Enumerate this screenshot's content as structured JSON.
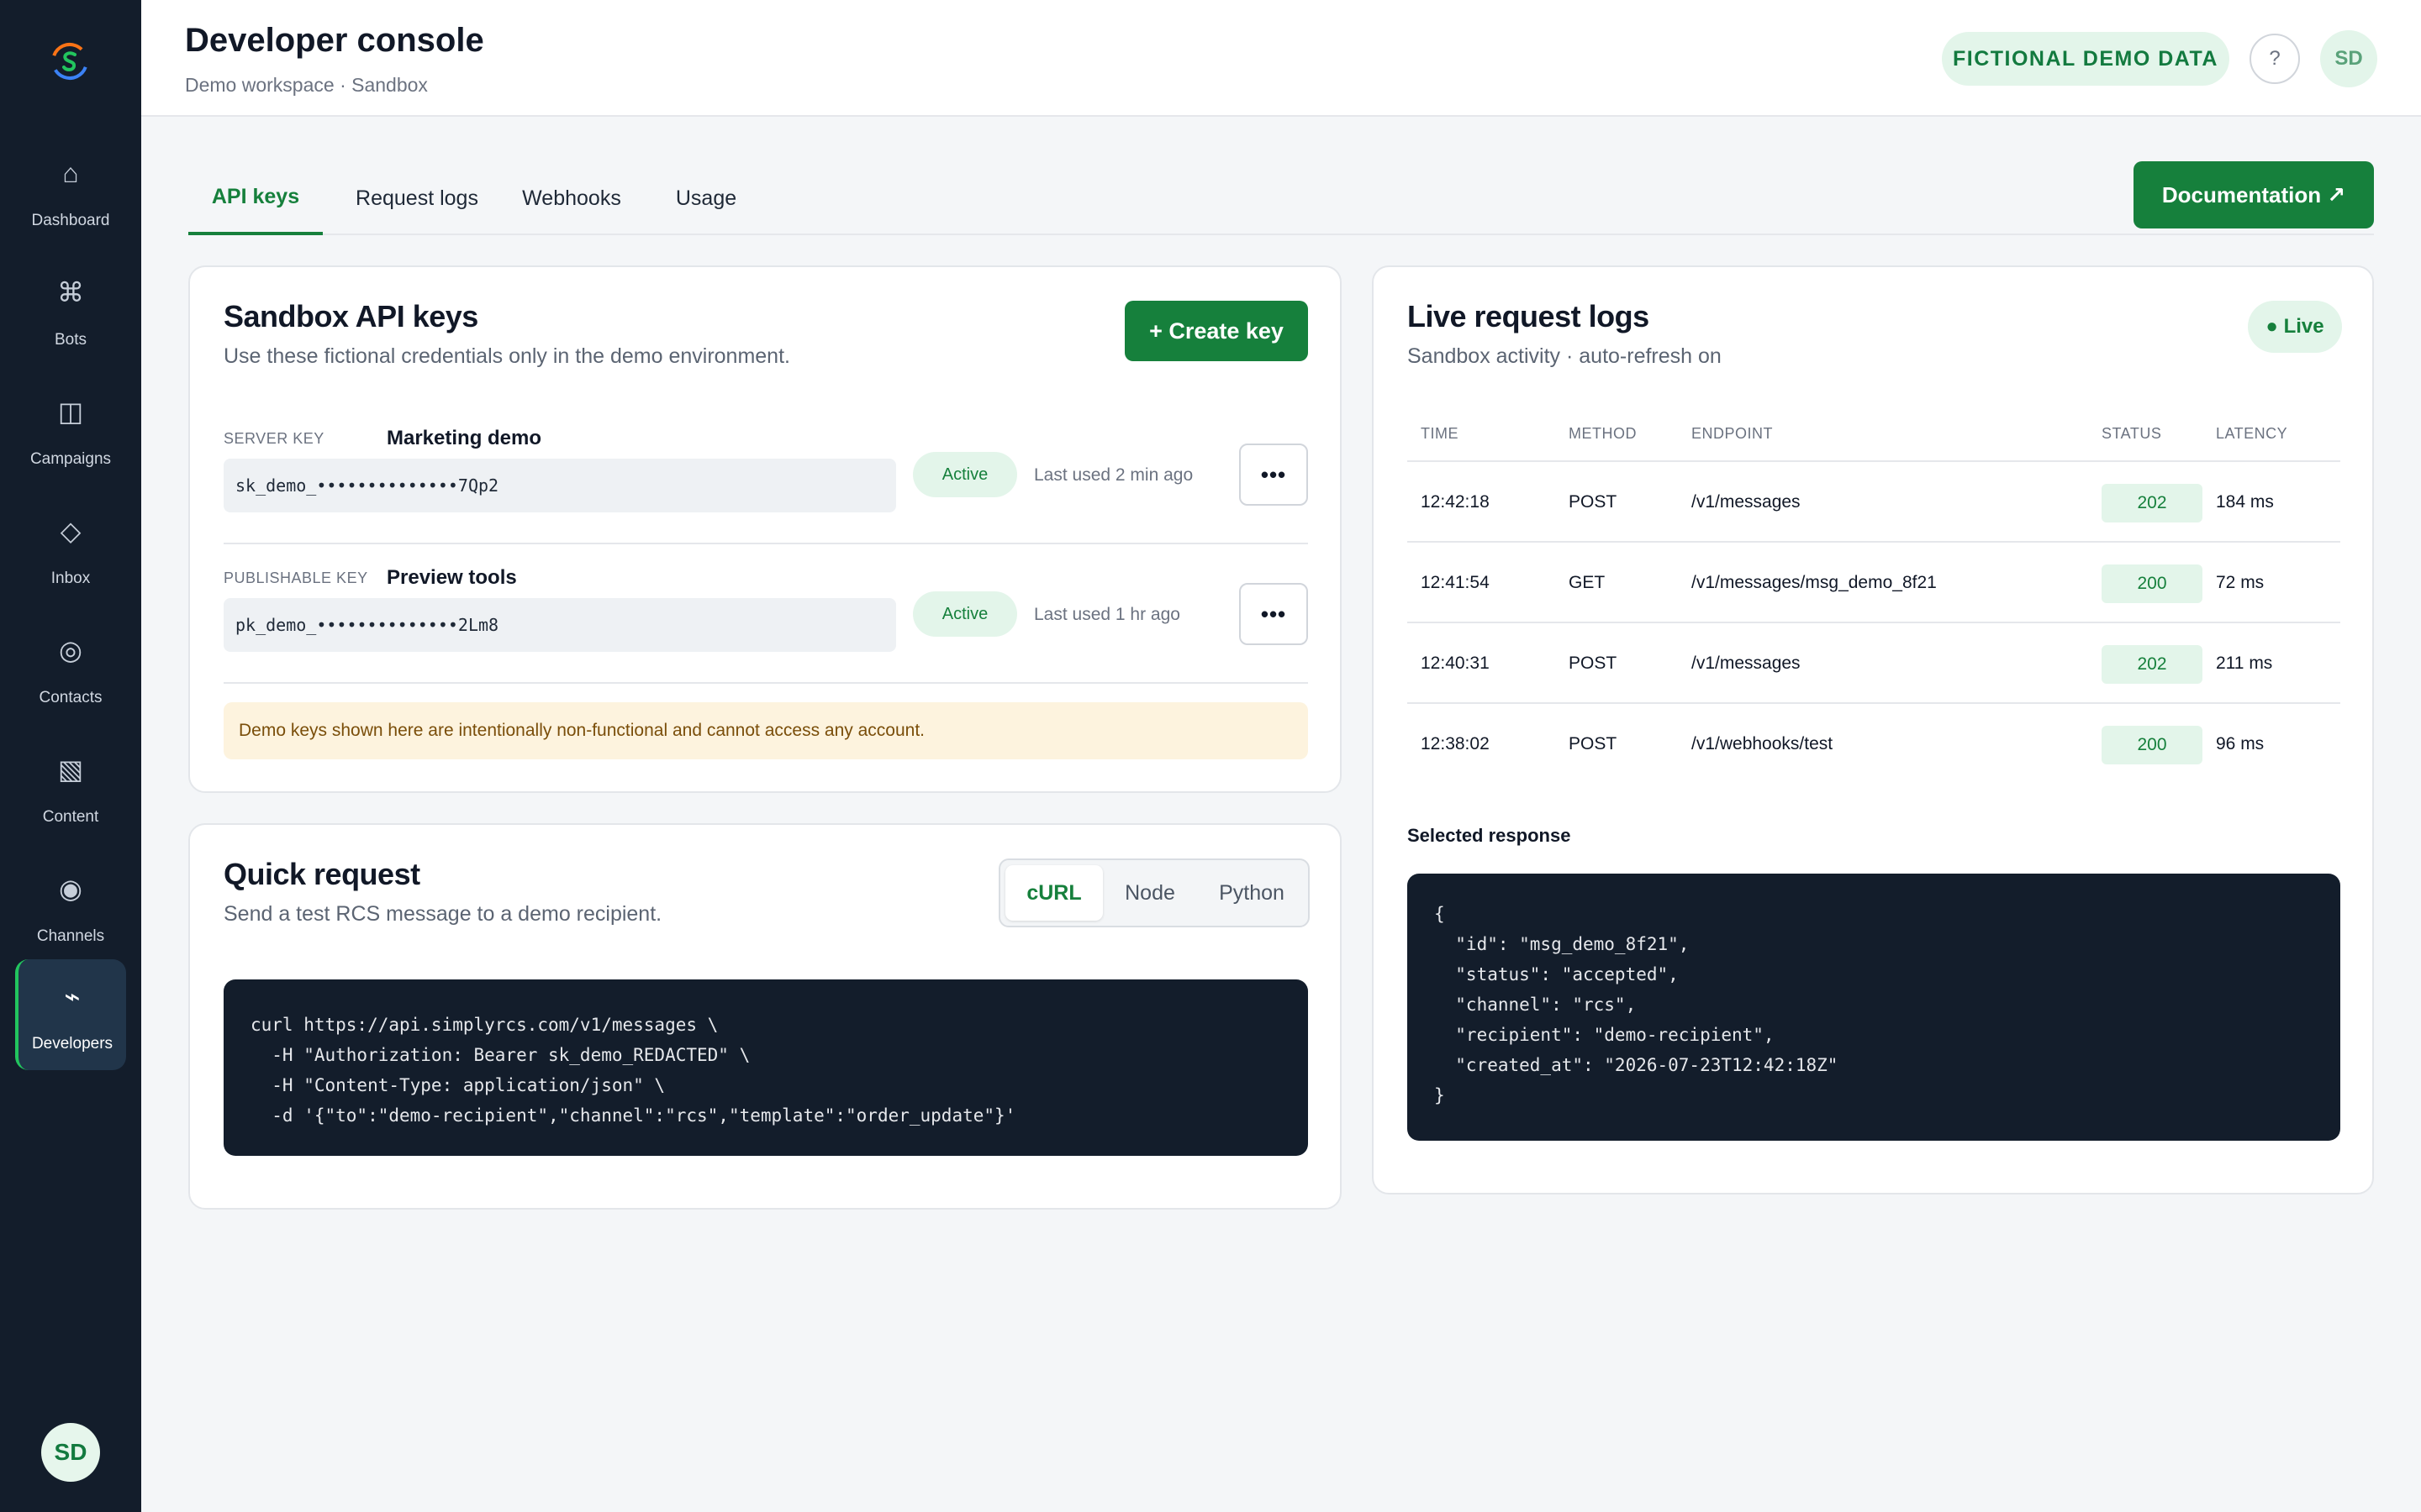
{
  "sidebar": {
    "items": [
      {
        "label": "Dashboard",
        "icon": "home-icon",
        "glyph": "⌂"
      },
      {
        "label": "Bots",
        "icon": "command-icon",
        "glyph": "⌘"
      },
      {
        "label": "Campaigns",
        "icon": "columns-icon",
        "glyph": "◫"
      },
      {
        "label": "Inbox",
        "icon": "diamond-icon",
        "glyph": "◇"
      },
      {
        "label": "Contacts",
        "icon": "circle-icon",
        "glyph": "◎"
      },
      {
        "label": "Content",
        "icon": "pattern-icon",
        "glyph": "▧"
      },
      {
        "label": "Channels",
        "icon": "radio-icon",
        "glyph": "◉"
      },
      {
        "label": "Developers",
        "icon": "bolt-icon",
        "glyph": "⌁"
      }
    ],
    "active": "Developers",
    "avatar": "SD"
  },
  "header": {
    "title": "Developer console",
    "breadcrumb": "Demo workspace · Sandbox",
    "badge": "FICTIONAL DEMO DATA",
    "help": "?",
    "avatar": "SD"
  },
  "tabs": [
    "API keys",
    "Request logs",
    "Webhooks",
    "Usage"
  ],
  "active_tab": "API keys",
  "documentation_button": "Documentation ↗",
  "api_keys": {
    "title": "Sandbox API keys",
    "subtitle": "Use these fictional credentials only in the demo environment.",
    "create_button": "+ Create key",
    "keys": [
      {
        "type": "SERVER KEY",
        "name": "Marketing demo",
        "value": "sk_demo_••••••••••••••7Qp2",
        "status": "Active",
        "last_used": "Last used 2 min ago",
        "more": "•••"
      },
      {
        "type": "PUBLISHABLE KEY",
        "name": "Preview tools",
        "value": "pk_demo_••••••••••••••2Lm8",
        "status": "Active",
        "last_used": "Last used 1 hr ago",
        "more": "•••"
      }
    ],
    "notice": "Demo keys shown here are intentionally non-functional and cannot access any account."
  },
  "quick_request": {
    "title": "Quick request",
    "subtitle": "Send a test RCS message to a demo recipient.",
    "languages": [
      "cURL",
      "Node",
      "Python"
    ],
    "active_language": "cURL",
    "code": "curl https://api.simplyrcs.com/v1/messages \\\n  -H \"Authorization: Bearer sk_demo_REDACTED\" \\\n  -H \"Content-Type: application/json\" \\\n  -d '{\"to\":\"demo-recipient\",\"channel\":\"rcs\",\"template\":\"order_update\"}'"
  },
  "logs": {
    "title": "Live request logs",
    "subtitle": "Sandbox activity · auto-refresh on",
    "live_badge": "● Live",
    "columns": [
      "TIME",
      "METHOD",
      "ENDPOINT",
      "STATUS",
      "LATENCY"
    ],
    "rows": [
      {
        "time": "12:42:18",
        "method": "POST",
        "endpoint": "/v1/messages",
        "status": "202",
        "latency": "184 ms"
      },
      {
        "time": "12:41:54",
        "method": "GET",
        "endpoint": "/v1/messages/msg_demo_8f21",
        "status": "200",
        "latency": "72 ms"
      },
      {
        "time": "12:40:31",
        "method": "POST",
        "endpoint": "/v1/messages",
        "status": "202",
        "latency": "211 ms"
      },
      {
        "time": "12:38:02",
        "method": "POST",
        "endpoint": "/v1/webhooks/test",
        "status": "200",
        "latency": "96 ms"
      }
    ],
    "selected_label": "Selected response",
    "response": "{\n  \"id\": \"msg_demo_8f21\",\n  \"status\": \"accepted\",\n  \"channel\": \"rcs\",\n  \"recipient\": \"demo-recipient\",\n  \"created_at\": \"2026-07-23T12:42:18Z\"\n}"
  },
  "colors": {
    "brand_green": "#16803c",
    "sidebar_bg": "#131d2b",
    "badge_bg": "#e3f5ea",
    "notice_bg": "#fdf3de"
  }
}
